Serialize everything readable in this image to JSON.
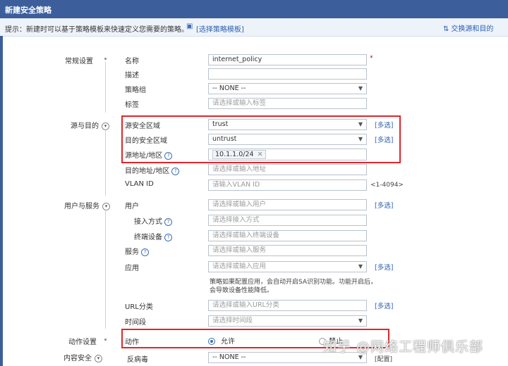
{
  "window": {
    "title": "新建安全策略"
  },
  "hint": {
    "text": "提示：新建时可以基于策略模板来快速定义您需要的策略。",
    "template_link": "[选择策略模板]",
    "swap_link": "交换源和目的"
  },
  "sections": {
    "general": "常规设置",
    "source_dest": "源与目的",
    "user_service": "用户与服务",
    "action": "动作设置",
    "content": "内容安全"
  },
  "fields": {
    "name": {
      "label": "名称",
      "value": "internet_policy",
      "required": "*"
    },
    "desc": {
      "label": "描述",
      "value": ""
    },
    "group": {
      "label": "策略组",
      "value": "-- NONE --"
    },
    "tag": {
      "label": "标签",
      "placeholder": "请选择或输入标签"
    },
    "src_zone": {
      "label": "源安全区域",
      "value": "trust",
      "multi": "[多选]"
    },
    "dst_zone": {
      "label": "目的安全区域",
      "value": "untrust",
      "multi": "[多选]"
    },
    "src_addr": {
      "label": "源地址/地区",
      "tag": "10.1.1.0/24"
    },
    "dst_addr": {
      "label": "目的地址/地区",
      "placeholder": "请选择或输入地址"
    },
    "vlan": {
      "label": "VLAN ID",
      "placeholder": "请输入VLAN ID",
      "range": "<1-4094>"
    },
    "user": {
      "label": "用户",
      "placeholder": "请选择或输入用户",
      "multi": "[多选]"
    },
    "access": {
      "label": "接入方式",
      "placeholder": "请选择接入方式"
    },
    "terminal": {
      "label": "终端设备",
      "placeholder": "请选择或输入终端设备"
    },
    "service": {
      "label": "服务",
      "placeholder": "请选择或输入服务"
    },
    "app": {
      "label": "应用",
      "placeholder": "请选择或输入应用",
      "multi": "[多选]",
      "note": "策略如果配置应用，会自动开启SA识别功能。功能开启后，会导致设备性能降低。"
    },
    "url": {
      "label": "URL分类",
      "placeholder": "请选择或输入URL分类",
      "multi": "[多选]"
    },
    "time": {
      "label": "时间段",
      "placeholder": "请选择时间段"
    },
    "action": {
      "label": "动作",
      "permit": "允许",
      "deny": "禁止"
    },
    "antivirus": {
      "label": "反病毒",
      "value": "-- NONE --",
      "config": "[配置]"
    }
  },
  "watermark": "知乎 @网络工程师俱乐部",
  "colors": {
    "titlebar": "#3c5f9c",
    "link": "#2b5fb0",
    "highlight": "#e0262a"
  },
  "icons": {
    "help": "question-circle-icon",
    "dropdown": "chevron-down-icon",
    "section": "collapse-circle-icon"
  }
}
